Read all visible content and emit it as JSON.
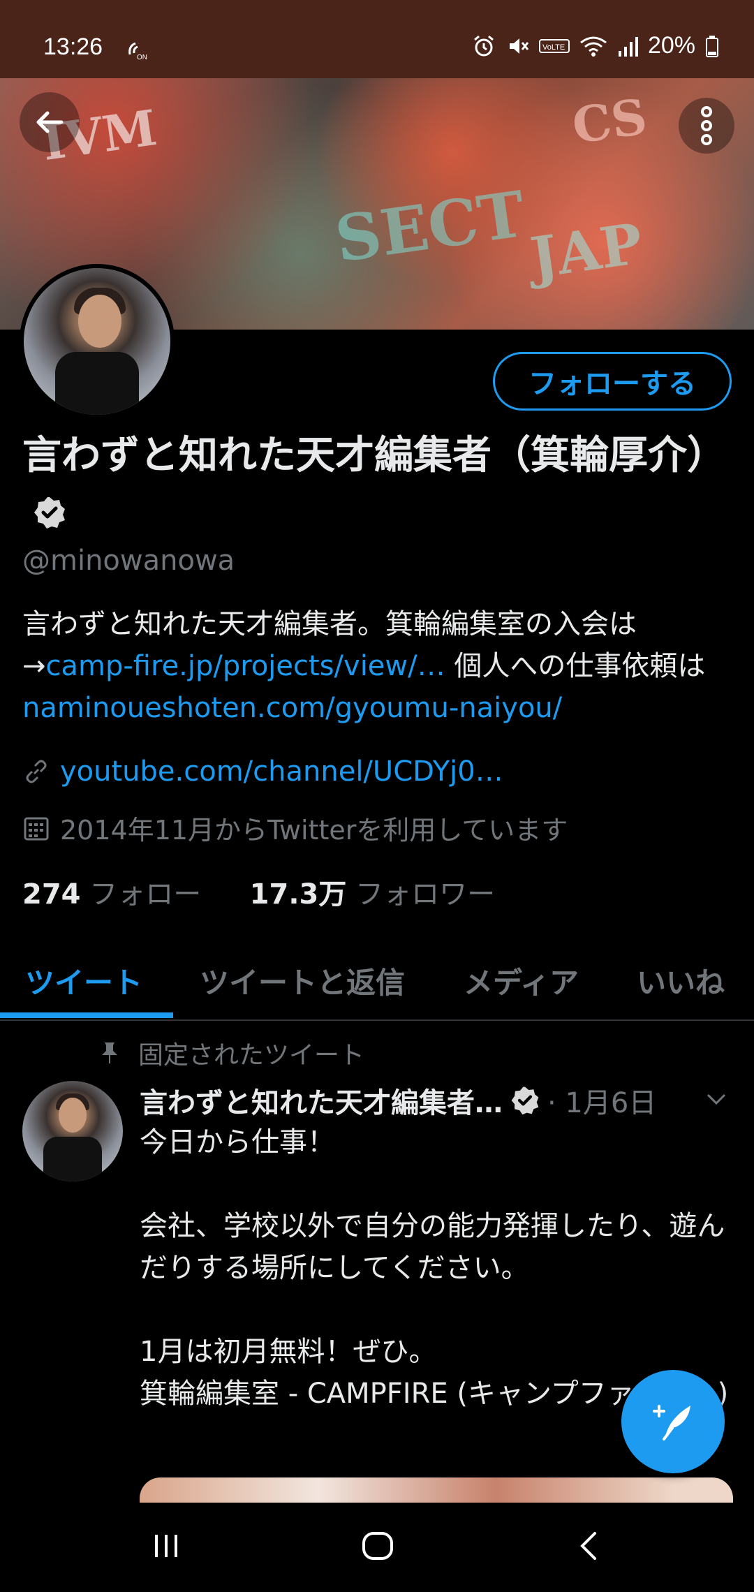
{
  "status_bar": {
    "time": "13:26",
    "battery": "20%"
  },
  "profile": {
    "follow_label": "フォローする",
    "name": "言わずと知れた天才編集者（箕輪厚介）",
    "handle": "@minowanowa",
    "bio": {
      "text1": "言わずと知れた天才編集者。箕輪編集室の入会は→",
      "link1": "camp-fire.jp/projects/view/…",
      "text2": " 個人への仕事依頼は",
      "link2": "naminoueshoten.com/gyoumu-naiyou/"
    },
    "website": "youtube.com/channel/UCDYj0…",
    "joined": "2014年11月からTwitterを利用しています",
    "following_count": "274",
    "following_label": "フォロー",
    "followers_count": "17.3万",
    "followers_label": "フォロワー"
  },
  "tabs": [
    {
      "label": "ツイート",
      "active": true
    },
    {
      "label": "ツイートと返信",
      "active": false
    },
    {
      "label": "メディア",
      "active": false
    },
    {
      "label": "いいね",
      "active": false
    }
  ],
  "pinned_tweet": {
    "pinned_label": "固定されたツイート",
    "author_name": "言わずと知れた天才編集者…",
    "date": "· 1月6日",
    "body": "今日から仕事！\n\n会社、学校以外で自分の能力発揮したり、遊んだりする場所にしてください。\n\n1月は初月無料！ぜひ。\n箕輪編集室 - CAMPFIRE (キャンプファイヤー)"
  },
  "colors": {
    "accent": "#1d9bf0",
    "background": "#000000",
    "status_bar": "#4a2419",
    "secondary_text": "#71767b"
  },
  "icons": {
    "back": "arrow-left-icon",
    "more": "more-vertical-icon",
    "verified": "verified-badge-icon",
    "link": "link-icon",
    "calendar": "calendar-icon",
    "pin": "pin-icon",
    "compose": "compose-tweet-icon"
  }
}
